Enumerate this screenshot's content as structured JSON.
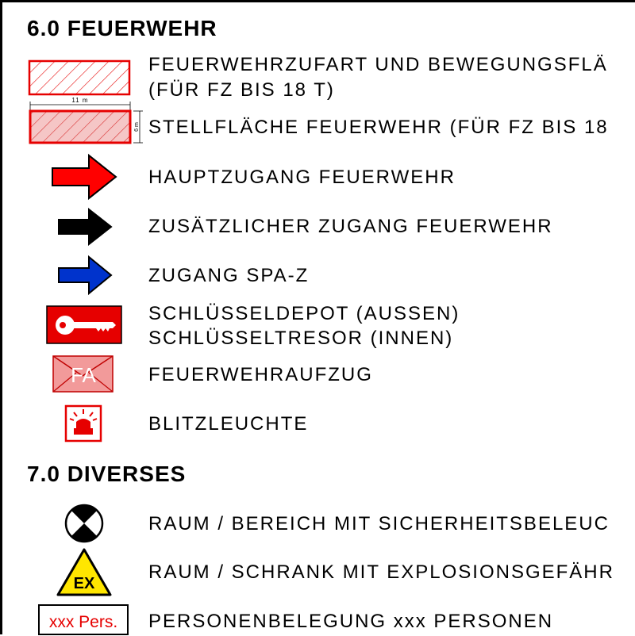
{
  "sections": [
    {
      "title": "6.0 FEUERWEHR",
      "items": [
        {
          "symbol": "hatched-rectangle-outline-icon",
          "lines": [
            "FEUERWEHRZUFART UND BEWEGUNGSFLÄ",
            "(FÜR FZ BIS 18 T)"
          ]
        },
        {
          "symbol": "hatched-rectangle-filled-icon",
          "dim_width": "11 m",
          "dim_height": "6 m",
          "lines": [
            "STELLFLÄCHE FEUERWEHR (FÜR FZ BIS 18"
          ]
        },
        {
          "symbol": "red-arrow-icon",
          "lines": [
            "HAUPTZUGANG FEUERWEHR"
          ]
        },
        {
          "symbol": "black-arrow-icon",
          "lines": [
            "ZUSÄTZLICHER ZUGANG FEUERWEHR"
          ]
        },
        {
          "symbol": "blue-arrow-icon",
          "lines": [
            "ZUGANG SPA-Z"
          ]
        },
        {
          "symbol": "key-icon",
          "lines": [
            "SCHLÜSSELDEPOT (AUSSEN)",
            "SCHLÜSSELTRESOR (INNEN)"
          ]
        },
        {
          "symbol": "fire-elevator-icon",
          "badge": "FA",
          "lines": [
            "FEUERWEHRAUFZUG"
          ]
        },
        {
          "symbol": "beacon-icon",
          "lines": [
            "BLITZLEUCHTE"
          ]
        }
      ]
    },
    {
      "title": "7.0 DIVERSES",
      "items": [
        {
          "symbol": "emergency-lighting-icon",
          "lines": [
            "RAUM / BEREICH MIT SICHERHEITSBELEUC"
          ]
        },
        {
          "symbol": "explosion-hazard-icon",
          "badge": "EX",
          "lines": [
            "RAUM / SCHRANK MIT EXPLOSIONSGEFÄHR"
          ]
        },
        {
          "symbol": "occupancy-box-icon",
          "badge": "xxx Pers.",
          "lines": [
            "PERSONENBELEGUNG xxx PERSONEN"
          ]
        }
      ]
    }
  ],
  "colors": {
    "red": "#e60000",
    "red_fill": "#f29a9a",
    "pink_hatch": "#f5c6c6",
    "blue": "#0033cc",
    "black": "#000000",
    "yellow": "#ffe600"
  }
}
